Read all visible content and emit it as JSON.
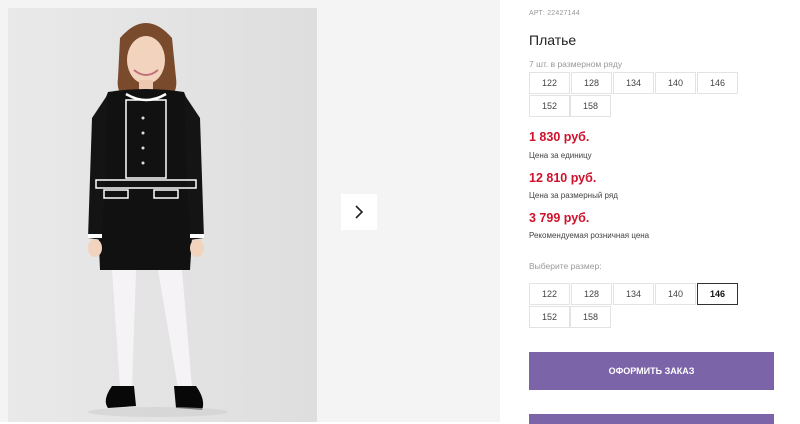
{
  "gallery": {
    "photo_alt": "product-photo",
    "next_icon": "chevron-right-icon"
  },
  "product": {
    "article": "АРТ: 22427144",
    "title": "Платье",
    "pack_note": "7 шт. в размерном ряду",
    "pack_sizes": [
      "122",
      "128",
      "134",
      "140",
      "146",
      "152",
      "158"
    ]
  },
  "prices": {
    "unit_price": "1 830 руб.",
    "unit_label": "Цена за единицу",
    "pack_price": "12 810 руб.",
    "pack_label": "Цена за размерный ряд",
    "retail_price": "3 799 руб.",
    "retail_label": "Рекомендуемая розничная цена"
  },
  "size_picker": {
    "label": "Выберите размер:",
    "options": [
      "122",
      "128",
      "134",
      "140",
      "146",
      "152",
      "158"
    ],
    "selected": "146"
  },
  "actions": {
    "order_label": "ОФОРМИТЬ ЗАКАЗ"
  },
  "colors": {
    "accent": "#7b64a8",
    "price": "#d0112b"
  }
}
